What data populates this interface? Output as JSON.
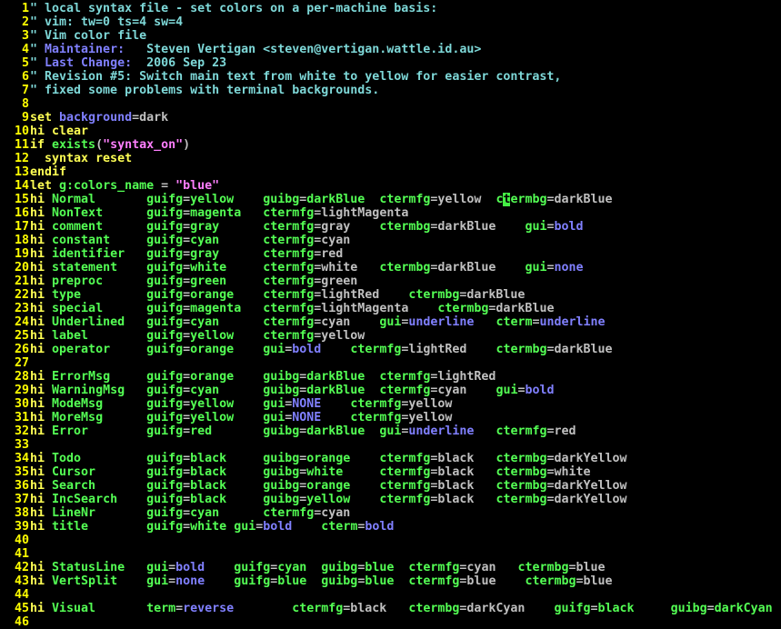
{
  "colors": {
    "comment": "#7ed8d8",
    "keyword": "#ffff54",
    "type": "#54ff54",
    "constant": "#ff7fff",
    "value": "#c0c0c0",
    "special": "#8080ff",
    "string": "#ff7fff",
    "linenr": "#ffff00"
  },
  "cursor": {
    "line": 15,
    "segment": 6
  },
  "lines": [
    [
      [
        "comment",
        "\" local syntax file - set colors on a per-machine basis:"
      ]
    ],
    [
      [
        "comment",
        "\" vim: tw=0 ts=4 sw=4"
      ]
    ],
    [
      [
        "comment",
        "\" Vim color file"
      ]
    ],
    [
      [
        "comment",
        "\" "
      ],
      [
        "special",
        "Maintainer:"
      ],
      [
        "comment",
        "   Steven Vertigan <steven@vertigan.wattle.id.au>"
      ]
    ],
    [
      [
        "comment",
        "\" "
      ],
      [
        "special",
        "Last Change:"
      ],
      [
        "comment",
        "  2006 Sep 23"
      ]
    ],
    [
      [
        "comment",
        "\" Revision #5: Switch main text from white to yellow for easier contrast,"
      ]
    ],
    [
      [
        "comment",
        "\" fixed some problems with terminal backgrounds."
      ]
    ],
    [],
    [
      [
        "keyword",
        "set "
      ],
      [
        "special",
        "background"
      ],
      [
        "value",
        "=dark"
      ]
    ],
    [
      [
        "keyword",
        "hi clear"
      ]
    ],
    [
      [
        "keyword",
        "if "
      ],
      [
        "type",
        "exists"
      ],
      [
        "value",
        "("
      ],
      [
        "string",
        "\"syntax_on\""
      ],
      [
        "value",
        ")"
      ]
    ],
    [
      [
        "keyword",
        "  syntax reset"
      ]
    ],
    [
      [
        "keyword",
        "endif"
      ]
    ],
    [
      [
        "keyword",
        "let "
      ],
      [
        "type",
        "g:colors_name"
      ],
      [
        "value",
        " = "
      ],
      [
        "string",
        "\"blue\""
      ]
    ],
    [
      [
        "keyword",
        "hi "
      ],
      [
        "type",
        "Normal       guifg"
      ],
      [
        "value",
        "="
      ],
      [
        "type",
        "yellow    guibg"
      ],
      [
        "value",
        "="
      ],
      [
        "type",
        "darkBlue  "
      ],
      [
        "type",
        "ctermfg"
      ],
      [
        "value",
        "=yellow  "
      ],
      [
        "type",
        "c"
      ],
      [
        "cursor",
        "t"
      ],
      [
        "type",
        "ermbg"
      ],
      [
        "value",
        "=darkBlue"
      ]
    ],
    [
      [
        "keyword",
        "hi "
      ],
      [
        "type",
        "NonText      guifg"
      ],
      [
        "value",
        "="
      ],
      [
        "type",
        "magenta   "
      ],
      [
        "type",
        "ctermfg"
      ],
      [
        "value",
        "=lightMagenta"
      ]
    ],
    [
      [
        "keyword",
        "hi "
      ],
      [
        "type",
        "comment      guifg"
      ],
      [
        "value",
        "="
      ],
      [
        "type",
        "gray      "
      ],
      [
        "type",
        "ctermfg"
      ],
      [
        "value",
        "=gray    "
      ],
      [
        "type",
        "ctermbg"
      ],
      [
        "value",
        "=darkBlue    "
      ],
      [
        "type",
        "gui"
      ],
      [
        "value",
        "="
      ],
      [
        "special",
        "bold"
      ]
    ],
    [
      [
        "keyword",
        "hi "
      ],
      [
        "type",
        "constant     guifg"
      ],
      [
        "value",
        "="
      ],
      [
        "type",
        "cyan      "
      ],
      [
        "type",
        "ctermfg"
      ],
      [
        "value",
        "=cyan"
      ]
    ],
    [
      [
        "keyword",
        "hi "
      ],
      [
        "type",
        "identifier   guifg"
      ],
      [
        "value",
        "="
      ],
      [
        "type",
        "gray      "
      ],
      [
        "type",
        "ctermfg"
      ],
      [
        "value",
        "=red"
      ]
    ],
    [
      [
        "keyword",
        "hi "
      ],
      [
        "type",
        "statement    guifg"
      ],
      [
        "value",
        "="
      ],
      [
        "type",
        "white     "
      ],
      [
        "type",
        "ctermfg"
      ],
      [
        "value",
        "=white   "
      ],
      [
        "type",
        "ctermbg"
      ],
      [
        "value",
        "=darkBlue    "
      ],
      [
        "type",
        "gui"
      ],
      [
        "value",
        "="
      ],
      [
        "special",
        "none"
      ]
    ],
    [
      [
        "keyword",
        "hi "
      ],
      [
        "type",
        "preproc      guifg"
      ],
      [
        "value",
        "="
      ],
      [
        "type",
        "green     "
      ],
      [
        "type",
        "ctermfg"
      ],
      [
        "value",
        "=green"
      ]
    ],
    [
      [
        "keyword",
        "hi "
      ],
      [
        "type",
        "type         guifg"
      ],
      [
        "value",
        "="
      ],
      [
        "type",
        "orange    "
      ],
      [
        "type",
        "ctermfg"
      ],
      [
        "value",
        "=lightRed    "
      ],
      [
        "type",
        "ctermbg"
      ],
      [
        "value",
        "=darkBlue"
      ]
    ],
    [
      [
        "keyword",
        "hi "
      ],
      [
        "type",
        "special      guifg"
      ],
      [
        "value",
        "="
      ],
      [
        "type",
        "magenta   "
      ],
      [
        "type",
        "ctermfg"
      ],
      [
        "value",
        "=lightMagenta    "
      ],
      [
        "type",
        "ctermbg"
      ],
      [
        "value",
        "=darkBlue"
      ]
    ],
    [
      [
        "keyword",
        "hi "
      ],
      [
        "type",
        "Underlined   guifg"
      ],
      [
        "value",
        "="
      ],
      [
        "type",
        "cyan      "
      ],
      [
        "type",
        "ctermfg"
      ],
      [
        "value",
        "=cyan    "
      ],
      [
        "type",
        "gui"
      ],
      [
        "value",
        "="
      ],
      [
        "special",
        "underline"
      ],
      [
        "value",
        "   "
      ],
      [
        "type",
        "cterm"
      ],
      [
        "value",
        "="
      ],
      [
        "special",
        "underline"
      ]
    ],
    [
      [
        "keyword",
        "hi "
      ],
      [
        "type",
        "label        guifg"
      ],
      [
        "value",
        "="
      ],
      [
        "type",
        "yellow    "
      ],
      [
        "type",
        "ctermfg"
      ],
      [
        "value",
        "=yellow"
      ]
    ],
    [
      [
        "keyword",
        "hi "
      ],
      [
        "type",
        "operator     guifg"
      ],
      [
        "value",
        "="
      ],
      [
        "type",
        "orange    "
      ],
      [
        "type",
        "gui"
      ],
      [
        "value",
        "="
      ],
      [
        "special",
        "bold"
      ],
      [
        "value",
        "    "
      ],
      [
        "type",
        "ctermfg"
      ],
      [
        "value",
        "=lightRed    "
      ],
      [
        "type",
        "ctermbg"
      ],
      [
        "value",
        "=darkBlue"
      ]
    ],
    [],
    [
      [
        "keyword",
        "hi "
      ],
      [
        "type",
        "ErrorMsg     guifg"
      ],
      [
        "value",
        "="
      ],
      [
        "type",
        "orange    guibg"
      ],
      [
        "value",
        "="
      ],
      [
        "type",
        "darkBlue  "
      ],
      [
        "type",
        "ctermfg"
      ],
      [
        "value",
        "=lightRed"
      ]
    ],
    [
      [
        "keyword",
        "hi "
      ],
      [
        "type",
        "WarningMsg   guifg"
      ],
      [
        "value",
        "="
      ],
      [
        "type",
        "cyan      guibg"
      ],
      [
        "value",
        "="
      ],
      [
        "type",
        "darkBlue  "
      ],
      [
        "type",
        "ctermfg"
      ],
      [
        "value",
        "=cyan    "
      ],
      [
        "type",
        "gui"
      ],
      [
        "value",
        "="
      ],
      [
        "special",
        "bold"
      ]
    ],
    [
      [
        "keyword",
        "hi "
      ],
      [
        "type",
        "ModeMsg      guifg"
      ],
      [
        "value",
        "="
      ],
      [
        "type",
        "yellow    "
      ],
      [
        "type",
        "gui"
      ],
      [
        "value",
        "="
      ],
      [
        "special",
        "NONE"
      ],
      [
        "value",
        "    "
      ],
      [
        "type",
        "ctermfg"
      ],
      [
        "value",
        "=yellow"
      ]
    ],
    [
      [
        "keyword",
        "hi "
      ],
      [
        "type",
        "MoreMsg      guifg"
      ],
      [
        "value",
        "="
      ],
      [
        "type",
        "yellow    "
      ],
      [
        "type",
        "gui"
      ],
      [
        "value",
        "="
      ],
      [
        "special",
        "NONE"
      ],
      [
        "value",
        "    "
      ],
      [
        "type",
        "ctermfg"
      ],
      [
        "value",
        "=yellow"
      ]
    ],
    [
      [
        "keyword",
        "hi "
      ],
      [
        "type",
        "Error        guifg"
      ],
      [
        "value",
        "="
      ],
      [
        "type",
        "red       guibg"
      ],
      [
        "value",
        "="
      ],
      [
        "type",
        "darkBlue  "
      ],
      [
        "type",
        "gui"
      ],
      [
        "value",
        "="
      ],
      [
        "special",
        "underline"
      ],
      [
        "value",
        "   "
      ],
      [
        "type",
        "ctermfg"
      ],
      [
        "value",
        "=red"
      ]
    ],
    [],
    [
      [
        "keyword",
        "hi "
      ],
      [
        "type",
        "Todo         guifg"
      ],
      [
        "value",
        "="
      ],
      [
        "type",
        "black     guibg"
      ],
      [
        "value",
        "="
      ],
      [
        "type",
        "orange    "
      ],
      [
        "type",
        "ctermfg"
      ],
      [
        "value",
        "=black   "
      ],
      [
        "type",
        "ctermbg"
      ],
      [
        "value",
        "=darkYellow"
      ]
    ],
    [
      [
        "keyword",
        "hi "
      ],
      [
        "type",
        "Cursor       guifg"
      ],
      [
        "value",
        "="
      ],
      [
        "type",
        "black     guibg"
      ],
      [
        "value",
        "="
      ],
      [
        "type",
        "white     "
      ],
      [
        "type",
        "ctermfg"
      ],
      [
        "value",
        "=black   "
      ],
      [
        "type",
        "ctermbg"
      ],
      [
        "value",
        "=white"
      ]
    ],
    [
      [
        "keyword",
        "hi "
      ],
      [
        "type",
        "Search       guifg"
      ],
      [
        "value",
        "="
      ],
      [
        "type",
        "black     guibg"
      ],
      [
        "value",
        "="
      ],
      [
        "type",
        "orange    "
      ],
      [
        "type",
        "ctermfg"
      ],
      [
        "value",
        "=black   "
      ],
      [
        "type",
        "ctermbg"
      ],
      [
        "value",
        "=darkYellow"
      ]
    ],
    [
      [
        "keyword",
        "hi "
      ],
      [
        "type",
        "IncSearch    guifg"
      ],
      [
        "value",
        "="
      ],
      [
        "type",
        "black     guibg"
      ],
      [
        "value",
        "="
      ],
      [
        "type",
        "yellow    "
      ],
      [
        "type",
        "ctermfg"
      ],
      [
        "value",
        "=black   "
      ],
      [
        "type",
        "ctermbg"
      ],
      [
        "value",
        "=darkYellow"
      ]
    ],
    [
      [
        "keyword",
        "hi "
      ],
      [
        "type",
        "LineNr       guifg"
      ],
      [
        "value",
        "="
      ],
      [
        "type",
        "cyan      "
      ],
      [
        "type",
        "ctermfg"
      ],
      [
        "value",
        "=cyan"
      ]
    ],
    [
      [
        "keyword",
        "hi "
      ],
      [
        "type",
        "title        guifg"
      ],
      [
        "value",
        "="
      ],
      [
        "type",
        "white gui"
      ],
      [
        "value",
        "="
      ],
      [
        "special",
        "bold"
      ],
      [
        "value",
        "    "
      ],
      [
        "type",
        "cterm"
      ],
      [
        "value",
        "="
      ],
      [
        "special",
        "bold"
      ]
    ],
    [],
    [],
    [
      [
        "keyword",
        "hi "
      ],
      [
        "type",
        "StatusLine   gui"
      ],
      [
        "value",
        "="
      ],
      [
        "special",
        "bold"
      ],
      [
        "value",
        "    "
      ],
      [
        "type",
        "guifg"
      ],
      [
        "value",
        "="
      ],
      [
        "type",
        "cyan  guibg"
      ],
      [
        "value",
        "="
      ],
      [
        "type",
        "blue  "
      ],
      [
        "type",
        "ctermfg"
      ],
      [
        "value",
        "=cyan   "
      ],
      [
        "type",
        "ctermbg"
      ],
      [
        "value",
        "=blue"
      ]
    ],
    [
      [
        "keyword",
        "hi "
      ],
      [
        "type",
        "VertSplit    gui"
      ],
      [
        "value",
        "="
      ],
      [
        "special",
        "none"
      ],
      [
        "value",
        "    "
      ],
      [
        "type",
        "guifg"
      ],
      [
        "value",
        "="
      ],
      [
        "type",
        "blue  guibg"
      ],
      [
        "value",
        "="
      ],
      [
        "type",
        "blue  "
      ],
      [
        "type",
        "ctermfg"
      ],
      [
        "value",
        "=blue    "
      ],
      [
        "type",
        "ctermbg"
      ],
      [
        "value",
        "=blue"
      ]
    ],
    [],
    [
      [
        "keyword",
        "hi "
      ],
      [
        "type",
        "Visual       term"
      ],
      [
        "value",
        "="
      ],
      [
        "special",
        "reverse"
      ],
      [
        "value",
        "        "
      ],
      [
        "type",
        "ctermfg"
      ],
      [
        "value",
        "=black   "
      ],
      [
        "type",
        "ctermbg"
      ],
      [
        "value",
        "=darkCyan    "
      ],
      [
        "type",
        "guifg"
      ],
      [
        "value",
        "="
      ],
      [
        "type",
        "black     guibg"
      ],
      [
        "value",
        "="
      ],
      [
        "type",
        "darkCyan"
      ]
    ],
    []
  ]
}
